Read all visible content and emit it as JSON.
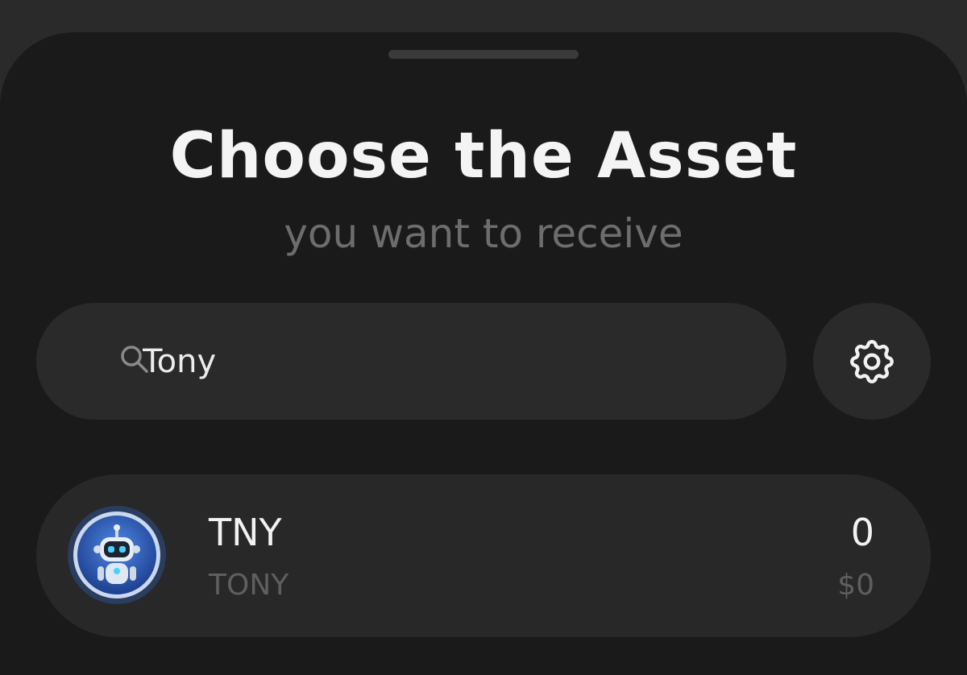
{
  "header": {
    "title": "Choose the Asset",
    "subtitle": "you want to receive"
  },
  "search": {
    "value": "Tony",
    "icon": "search-icon"
  },
  "settings": {
    "icon": "gear-icon"
  },
  "assets": [
    {
      "symbol": "TNY",
      "name": "TONY",
      "amount": "0",
      "fiat": "$0",
      "icon": "robot-token-icon"
    }
  ],
  "colors": {
    "background": "#1a1a1a",
    "surface": "#2a2a2a",
    "text_primary": "#f4f4f4",
    "text_secondary": "#6d6d6d",
    "token_blue": "#2f64c8"
  }
}
